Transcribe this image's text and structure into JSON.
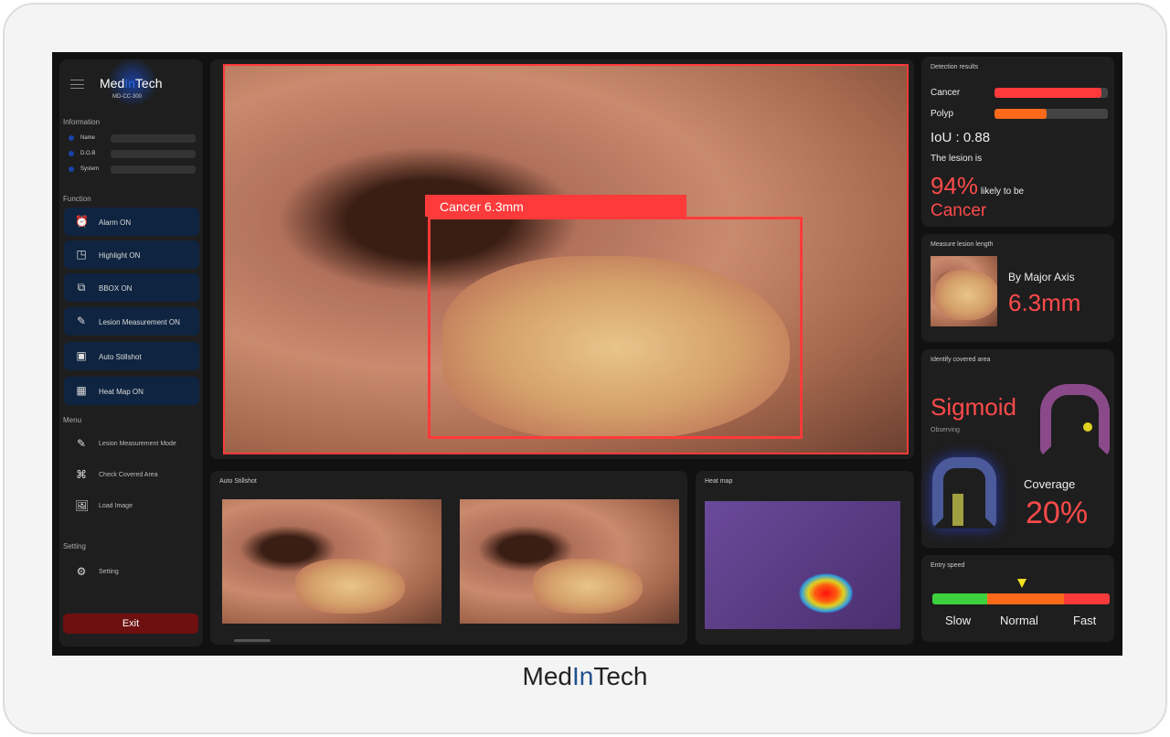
{
  "brand": {
    "name_a": "Med",
    "name_b": "In",
    "name_c": "Tech",
    "model": "MD-CC-300"
  },
  "sidebar": {
    "information_title": "Information",
    "info": [
      {
        "label": "Name"
      },
      {
        "label": "D.O.B"
      },
      {
        "label": "System"
      }
    ],
    "function_title": "Function",
    "functions": [
      {
        "label": "Alarm ON",
        "icon": "alarm-clock-icon"
      },
      {
        "label": "Highlight ON",
        "icon": "highlight-icon"
      },
      {
        "label": "BBOX ON",
        "icon": "bbox-icon"
      },
      {
        "label": "Lesion Measurement ON",
        "icon": "ruler-icon"
      },
      {
        "label": "Auto Stillshot",
        "icon": "stillshot-icon"
      },
      {
        "label": "Heat Map ON",
        "icon": "heatmap-icon"
      }
    ],
    "menu_title": "Menu",
    "menu": [
      {
        "label": "Lesion Measurement Mode",
        "icon": "ruler-icon"
      },
      {
        "label": "Check Covered Area",
        "icon": "colon-icon"
      },
      {
        "label": "Load Image",
        "icon": "image-icon"
      }
    ],
    "setting_title": "Setting",
    "setting": {
      "label": "Setting",
      "icon": "gear-icon"
    },
    "exit_label": "Exit"
  },
  "main_view": {
    "bbox_label": "Cancer 6.3mm"
  },
  "stillshot": {
    "title": "Auto Stillshot"
  },
  "heatmap": {
    "title": "Heat map"
  },
  "detection": {
    "title": "Detection results",
    "items": [
      {
        "label": "Cancer",
        "value": 0.94,
        "color": "#ff3a3a"
      },
      {
        "label": "Polyp",
        "value": 0.46,
        "color": "#ff6a1a"
      }
    ],
    "iou": "IoU : 0.88",
    "lesion_is": "The lesion is",
    "percent": "94%",
    "likely": "likely to be",
    "result": "Cancer"
  },
  "measure": {
    "title": "Measure lesion length",
    "by": "By Major Axis",
    "value": "6.3mm"
  },
  "covered": {
    "title": "Identify covered area",
    "region": "Sigmoid",
    "status": "Observing",
    "coverage_label": "Coverage",
    "coverage": "20%"
  },
  "speed": {
    "title": "Entry speed",
    "labels": [
      "Slow",
      "Normal",
      "Fast"
    ],
    "current": "Normal",
    "colors": [
      "#3ed13e",
      "#ff6a1a",
      "#ff3a3a"
    ]
  }
}
